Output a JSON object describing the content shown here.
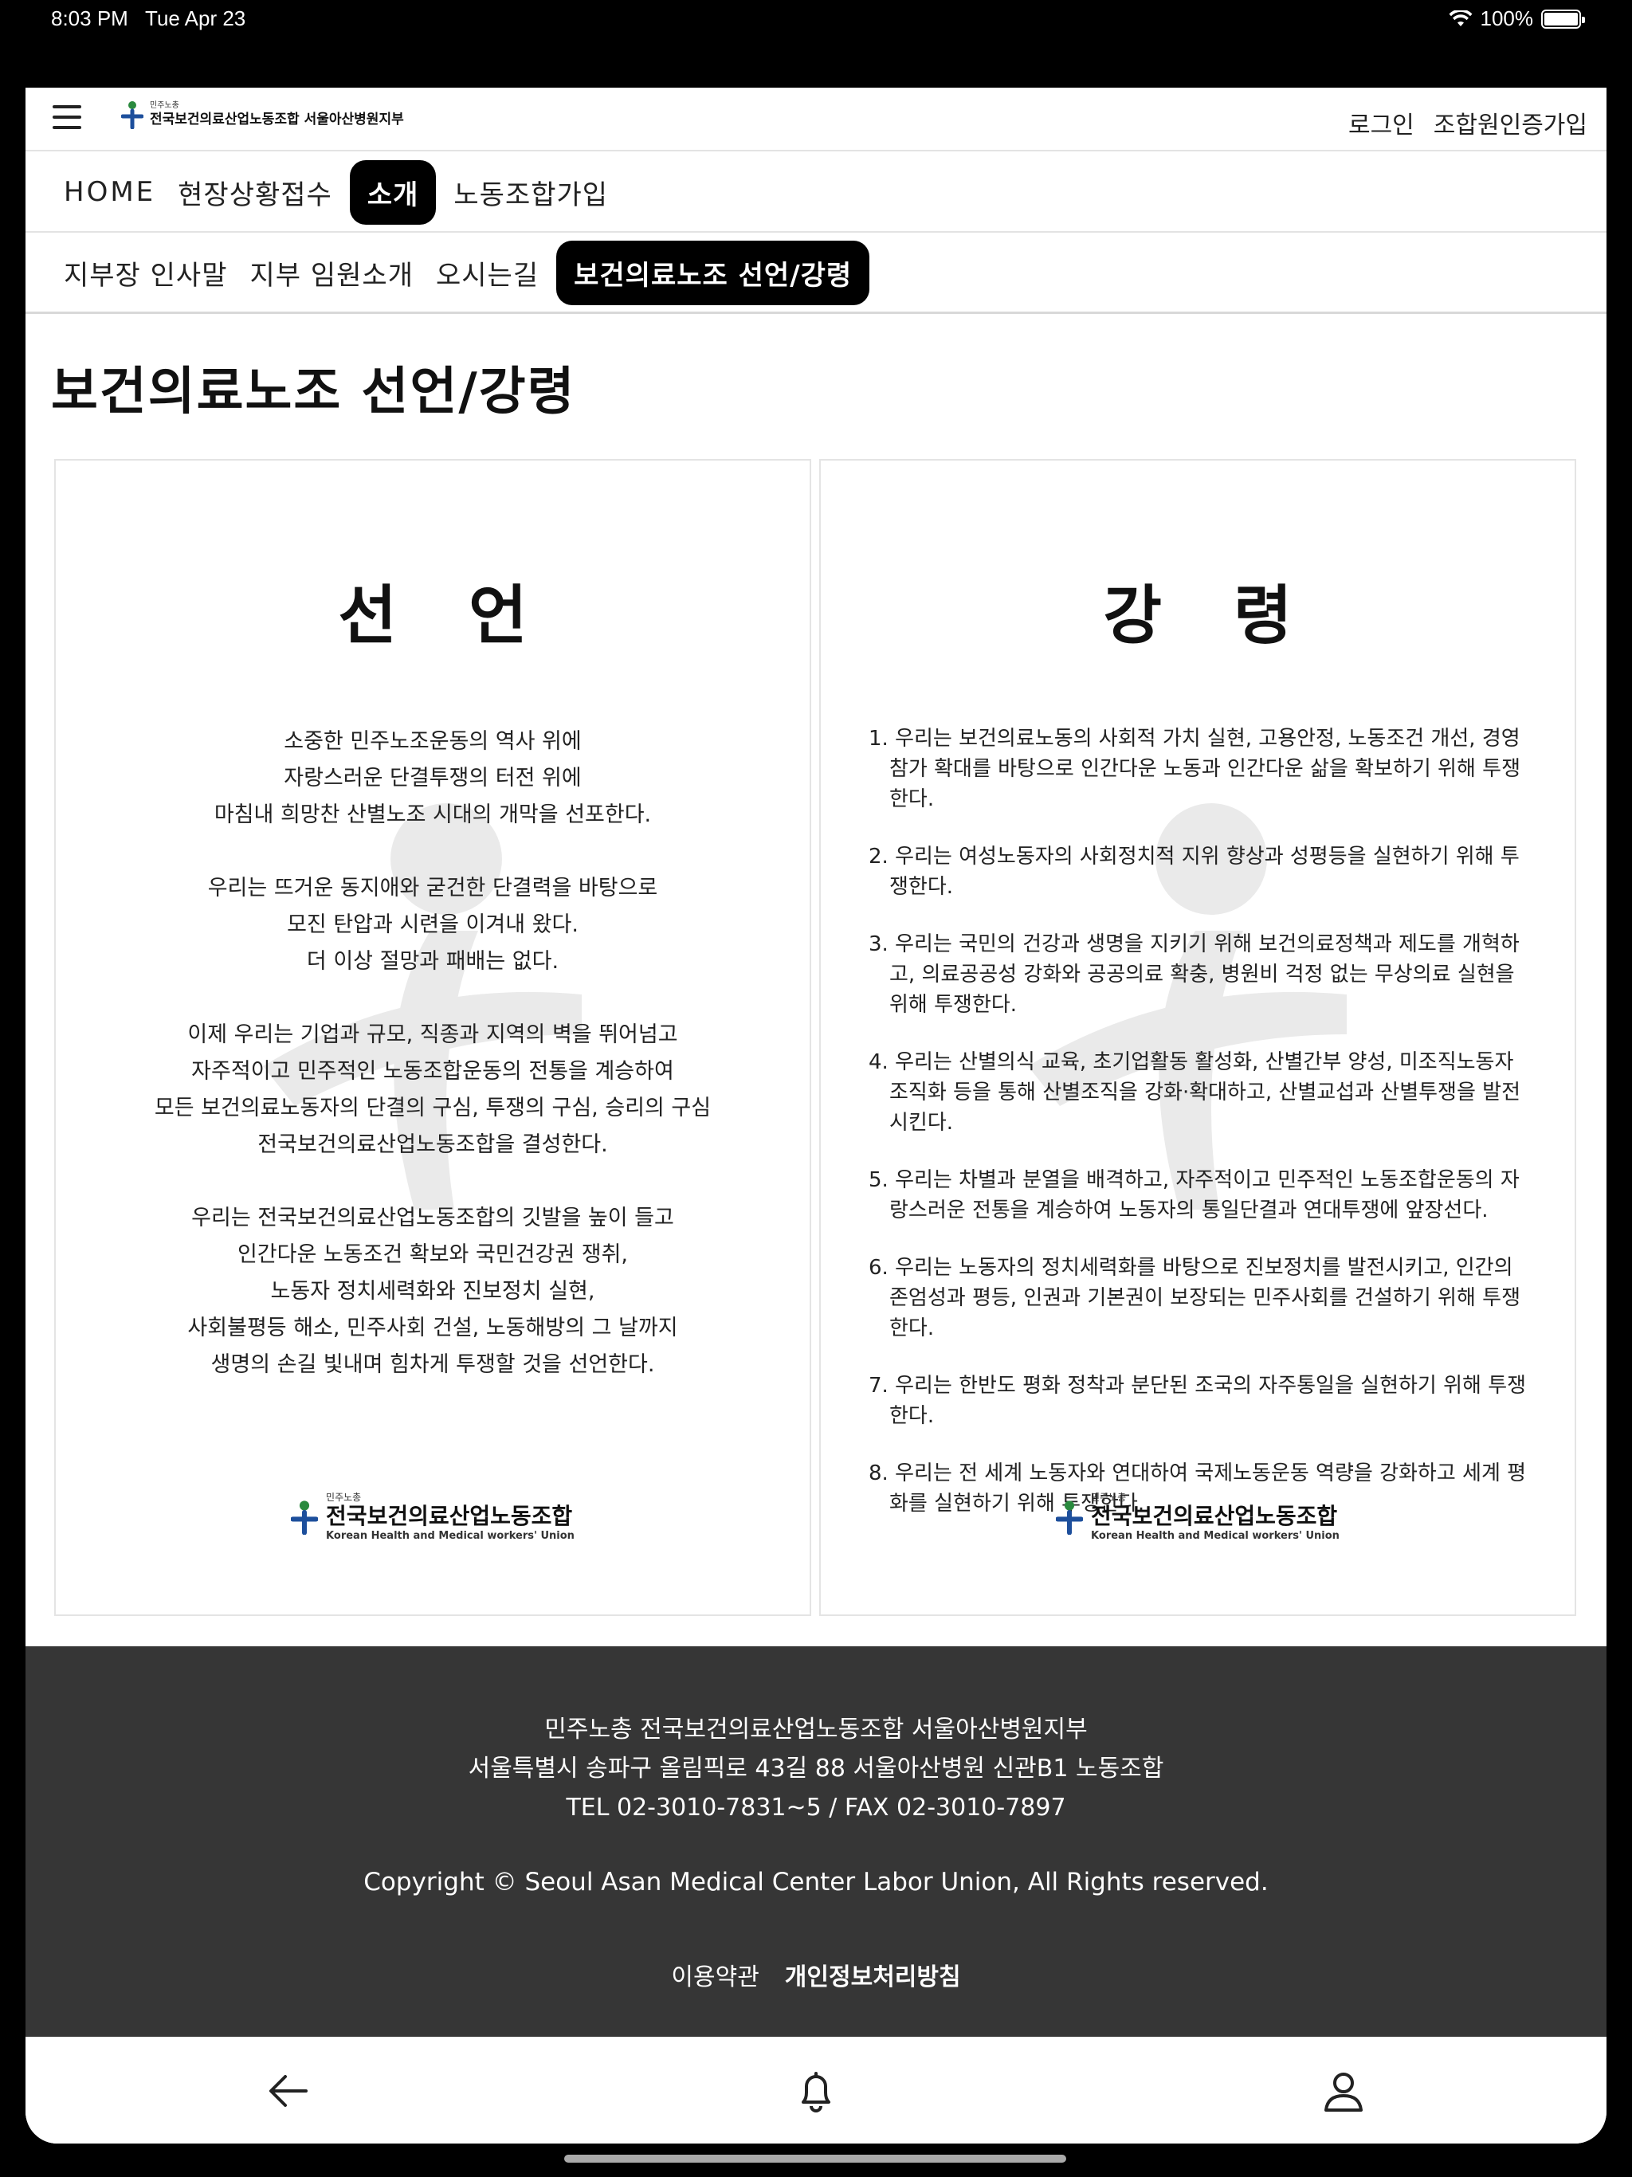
{
  "status_bar": {
    "time": "8:03 PM",
    "date": "Tue Apr 23",
    "battery": "100%"
  },
  "header": {
    "logo_small": "민주노총",
    "logo_text": "전국보건의료산업노동조합 서울아산병원지부",
    "login": "로그인",
    "signup": "조합원인증가입"
  },
  "nav_main": [
    {
      "label": "HOME",
      "active": false
    },
    {
      "label": "현장상황접수",
      "active": false
    },
    {
      "label": "소개",
      "active": true
    },
    {
      "label": "노동조합가입",
      "active": false
    }
  ],
  "nav_sub": [
    {
      "label": "지부장 인사말",
      "active": false
    },
    {
      "label": "지부 임원소개",
      "active": false
    },
    {
      "label": "오시는길",
      "active": false
    },
    {
      "label": "보건의료노조 선언/강령",
      "active": true
    }
  ],
  "page_title": "보건의료노조 선언/강령",
  "declaration": {
    "title": "선언",
    "paragraphs": [
      [
        "소중한 민주노조운동의 역사 위에",
        "자랑스러운 단결투쟁의 터전 위에",
        "마침내 희망찬 산별노조 시대의 개막을 선포한다."
      ],
      [
        "우리는 뜨거운 동지애와 굳건한 단결력을 바탕으로",
        "모진 탄압과 시련을 이겨내 왔다.",
        "더 이상 절망과 패배는 없다."
      ],
      [
        "이제 우리는 기업과 규모, 직종과 지역의 벽을 뛰어넘고",
        "자주적이고 민주적인 노동조합운동의 전통을 계승하여",
        "모든 보건의료노동자의 단결의 구심, 투쟁의 구심, 승리의 구심",
        "전국보건의료산업노동조합을 결성한다."
      ],
      [
        "우리는 전국보건의료산업노동조합의 깃발을 높이 들고",
        "인간다운 노동조건 확보와 국민건강권 쟁취,",
        "노동자 정치세력화와 진보정치 실현,",
        "사회불평등 해소, 민주사회 건설, 노동해방의 그 날까지",
        "생명의 손길 빛내며 힘차게 투쟁할 것을 선언한다."
      ]
    ]
  },
  "program": {
    "title": "강령",
    "items": [
      "1. 우리는 보건의료노동의 사회적 가치 실현, 고용안정, 노동조건 개선, 경영참가 확대를 바탕으로 인간다운 노동과 인간다운 삶을 확보하기 위해 투쟁한다.",
      "2. 우리는 여성노동자의 사회정치적 지위 향상과 성평등을 실현하기 위해 투쟁한다.",
      "3. 우리는 국민의 건강과 생명을 지키기 위해 보건의료정책과 제도를 개혁하고, 의료공공성 강화와 공공의료 확충, 병원비 걱정 없는 무상의료 실현을 위해 투쟁한다.",
      "4. 우리는 산별의식 교육, 초기업활동 활성화, 산별간부 양성, 미조직노동자 조직화 등을 통해 산별조직을 강화·확대하고, 산별교섭과 산별투쟁을 발전시킨다.",
      "5. 우리는 차별과 분열을 배격하고, 자주적이고 민주적인 노동조합운동의 자랑스러운 전통을 계승하여 노동자의 통일단결과 연대투쟁에 앞장선다.",
      "6. 우리는 노동자의 정치세력화를 바탕으로 진보정치를 발전시키고, 인간의 존엄성과 평등, 인권과 기본권이 보장되는 민주사회를 건설하기 위해 투쟁한다.",
      "7. 우리는 한반도 평화 정착과 분단된 조국의 자주통일을 실현하기 위해 투쟁한다.",
      "8. 우리는 전 세계 노동자와 연대하여 국제노동운동 역량을 강화하고 세계 평화를 실현하기 위해 투쟁한다."
    ]
  },
  "union_logo": {
    "small": "민주노총",
    "name": "전국보건의료산업노동조합",
    "english": "Korean Health and Medical workers' Union"
  },
  "footer": {
    "line1": "민주노총 전국보건의료산업노동조합 서울아산병원지부",
    "line2": "서울특별시 송파구 올림픽로 43길 88 서울아산병원 신관B1 노동조합",
    "line3": "TEL 02-3010-7831~5 / FAX 02-3010-7897",
    "copyright": "Copyright © Seoul Asan Medical Center Labor Union, All Rights reserved.",
    "terms": "이용약관",
    "privacy": "개인정보처리방침"
  },
  "bottom_nav": [
    "back-arrow-icon",
    "bell-icon",
    "user-icon"
  ]
}
